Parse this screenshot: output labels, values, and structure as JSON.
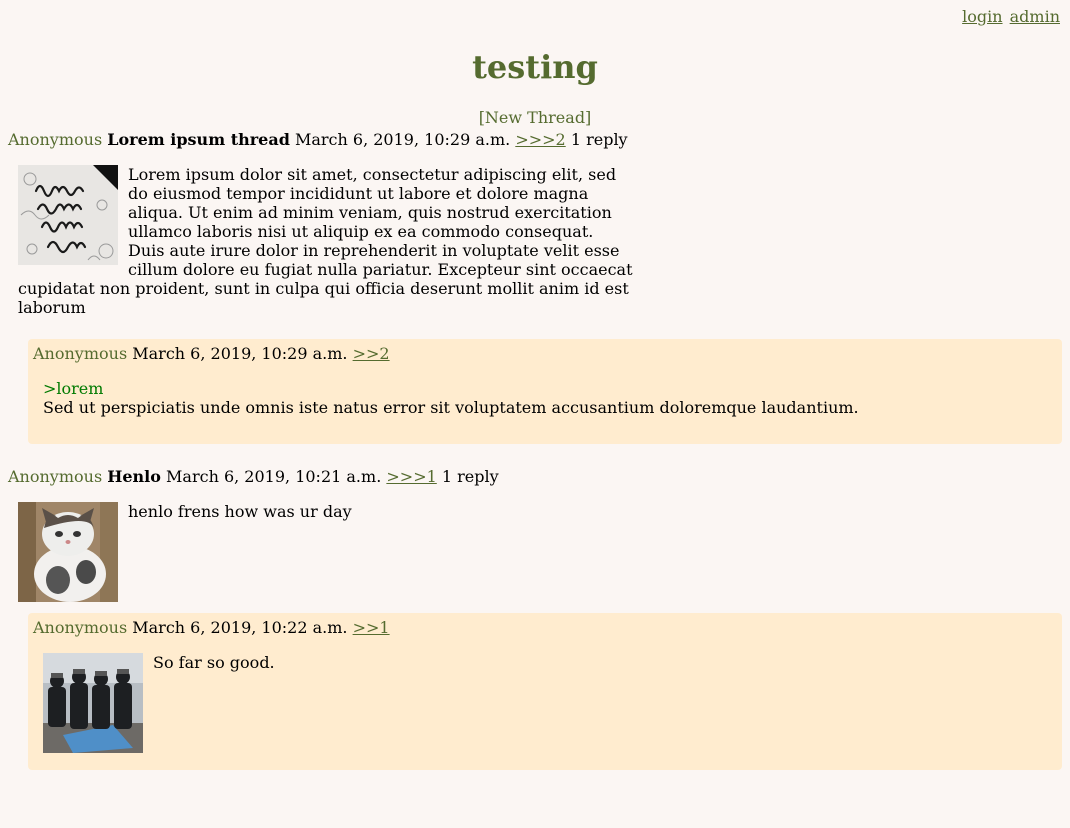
{
  "nav": {
    "login": "login",
    "admin": "admin"
  },
  "board": {
    "title": "testing",
    "new_thread": "[New Thread]"
  },
  "threads": [
    {
      "poster": "Anonymous",
      "subject": "Lorem ipsum thread",
      "date": "March 6, 2019, 10:29 a.m.",
      "link": ">>>2",
      "replies_label": "1 reply",
      "image_icon": "lorem-ipsum-lettering-image",
      "body": "Lorem ipsum dolor sit amet, consectetur adipiscing elit, sed do eiusmod tempor incididunt ut labore et dolore magna aliqua. Ut enim ad minim veniam, quis nostrud exercitation ullamco laboris nisi ut aliquip ex ea commodo consequat. Duis aute irure dolor in reprehenderit in voluptate velit esse cillum dolore eu fugiat nulla pariatur. Excepteur sint occaecat cupidatat non proident, sunt in culpa qui officia deserunt mollit anim id est laborum",
      "reply": {
        "poster": "Anonymous",
        "date": "March 6, 2019, 10:29 a.m.",
        "link": ">>2",
        "greentext": ">lorem",
        "body": "Sed ut perspiciatis unde omnis iste natus error sit voluptatem accusantium doloremque laudantium."
      }
    },
    {
      "poster": "Anonymous",
      "subject": "Henlo",
      "date": "March 6, 2019, 10:21 a.m.",
      "link": ">>>1",
      "replies_label": "1 reply",
      "image_icon": "cat-photo-image",
      "body": "henlo frens how was ur day",
      "reply": {
        "poster": "Anonymous",
        "date": "March 6, 2019, 10:22 a.m.",
        "link": ">>1",
        "image_icon": "police-photo-image",
        "body": "So far so good."
      }
    }
  ]
}
